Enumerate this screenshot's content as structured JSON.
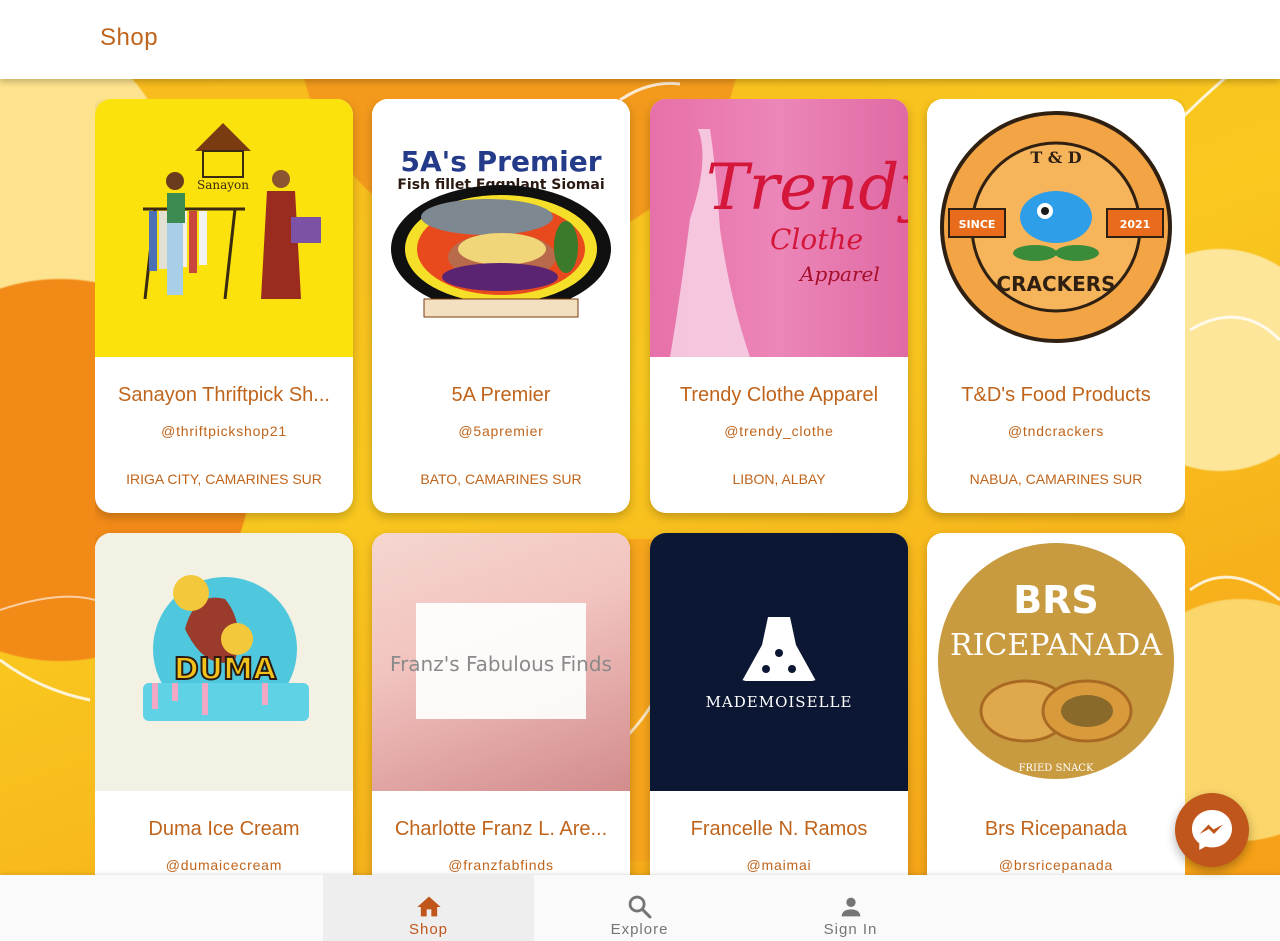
{
  "app": {
    "title": "Shop"
  },
  "shops": [
    {
      "name": "Sanayon Thriftpick Sh...",
      "handle": "@thriftpickshop21",
      "location": "IRIGA CITY, CAMARINES SUR",
      "logo_text": "Sanayon"
    },
    {
      "name": "5A Premier",
      "handle": "@5apremier",
      "location": "BATO, CAMARINES SUR",
      "logo_text": "5A's Premier",
      "logo_subtext": "Fish fillet Eggplant Siomai"
    },
    {
      "name": "Trendy Clothe Apparel",
      "handle": "@trendy_clothe",
      "location": "LIBON, ALBAY",
      "logo_text": "Trendy",
      "logo_subtext": "Clothe",
      "logo_subtext2": "Apparel"
    },
    {
      "name": "T&D's Food Products",
      "handle": "@tndcrackers",
      "location": "NABUA, CAMARINES SUR",
      "logo_text": "T & D",
      "logo_subtext": "CRACKERS",
      "logo_since": "SINCE",
      "logo_year": "2021"
    },
    {
      "name": "Duma Ice Cream",
      "handle": "@dumaicecream",
      "location": "",
      "logo_text": "DUMA"
    },
    {
      "name": "Charlotte Franz L. Are...",
      "handle": "@franzfabfinds",
      "location": "",
      "logo_text": "Franz's Fabulous Finds"
    },
    {
      "name": "Francelle N. Ramos",
      "handle": "@maimai",
      "location": "",
      "logo_text": "MADEMOISELLE"
    },
    {
      "name": "Brs Ricepanada",
      "handle": "@brsricepanada",
      "location": "",
      "logo_text": "BRS",
      "logo_subtext": "RICEPANADA",
      "logo_subtext2": "FRIED SNACK"
    }
  ],
  "bottom_nav": {
    "items": [
      {
        "label": "Shop",
        "icon": "home-icon",
        "active": true
      },
      {
        "label": "Explore",
        "icon": "search-icon",
        "active": false
      },
      {
        "label": "Sign In",
        "icon": "person-icon",
        "active": false
      }
    ]
  },
  "fab": {
    "icon": "messenger-icon"
  },
  "colors": {
    "accent": "#c0641b",
    "fab": "#c0561b",
    "background": "#f8c21a"
  }
}
